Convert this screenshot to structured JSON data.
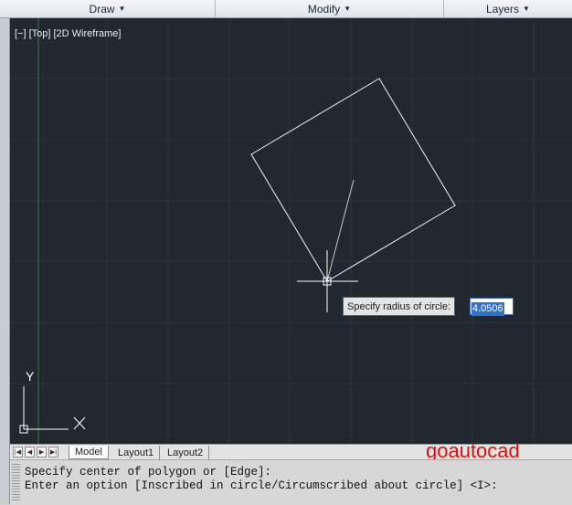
{
  "ribbon": {
    "panels": [
      {
        "label": "Draw",
        "icon": "chevron-down-icon"
      },
      {
        "label": "Modify",
        "icon": "chevron-down-icon"
      },
      {
        "label": "Layers",
        "icon": "chevron-down-icon"
      }
    ]
  },
  "viewport": {
    "label": "[−] [Top] [2D Wireframe]",
    "background": "#212830",
    "axis_y": "Y",
    "axis_x": "X",
    "dynamic_input": {
      "prompt": "Specify radius of circle:",
      "value": "4.0506"
    }
  },
  "tabs": {
    "nav_icons": [
      "first-tab-icon",
      "prev-tab-icon",
      "next-tab-icon",
      "last-tab-icon"
    ],
    "items": [
      {
        "label": "Model",
        "active": true
      },
      {
        "label": "Layout1",
        "active": false
      },
      {
        "label": "Layout2",
        "active": false
      }
    ]
  },
  "watermark": "goautocad",
  "command": {
    "lines": [
      "Specify center of polygon or [Edge]:",
      "Enter an option [Inscribed in circle/Circumscribed about circle] <I>:"
    ]
  }
}
